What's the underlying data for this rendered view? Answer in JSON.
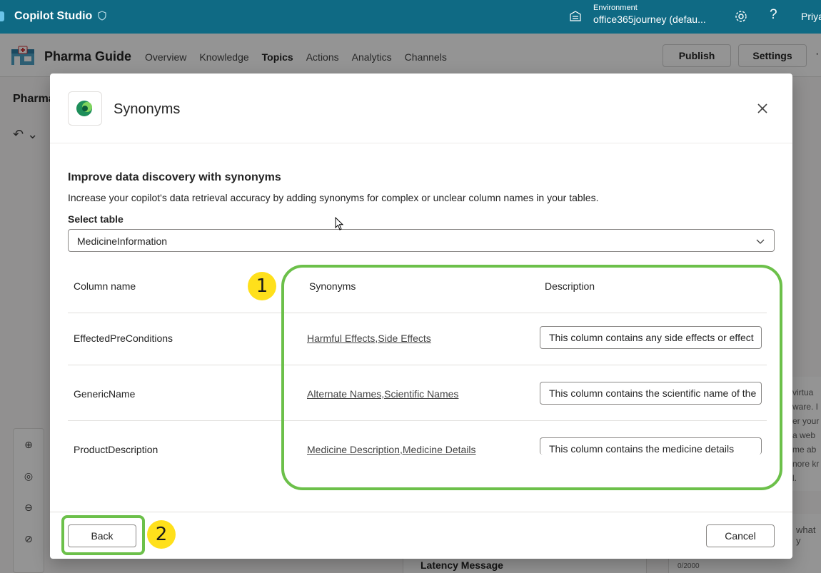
{
  "topbar": {
    "app_title": "Copilot Studio",
    "environment_label": "Environment",
    "environment_value": "office365journey (defau...",
    "user": "Priya"
  },
  "agent": {
    "name": "Pharma Guide",
    "nav": [
      "Overview",
      "Knowledge",
      "Topics",
      "Actions",
      "Analytics",
      "Channels"
    ],
    "active_nav": "Topics",
    "publish_label": "Publish",
    "settings_label": "Settings"
  },
  "background": {
    "left_title": "Pharma",
    "right_panel_lines": [
      "virtua",
      "ware. I",
      "er your",
      "a web",
      "me ab",
      "nore kr",
      "l."
    ],
    "latency_label": "Latency Message",
    "char_counter": "0/2000",
    "what_text": "what y"
  },
  "dialog": {
    "title": "Synonyms",
    "heading": "Improve data discovery with synonyms",
    "description": "Increase your copilot's data retrieval accuracy by adding synonyms for complex or unclear column names in your tables.",
    "select_label": "Select table",
    "select_value": "MedicineInformation",
    "columns": {
      "name": "Column name",
      "synonyms": "Synonyms",
      "description": "Description"
    },
    "rows": [
      {
        "column": "EffectedPreConditions",
        "synonyms": "Harmful Effects,Side Effects",
        "description": "This column contains any side effects or effect"
      },
      {
        "column": "GenericName",
        "synonyms": "Alternate Names,Scientific Names",
        "description": "This column contains the scientific name of the"
      },
      {
        "column": "ProductDescription",
        "synonyms": "Medicine Description,Medicine Details",
        "description": "This column contains the medicine details"
      }
    ],
    "back_label": "Back",
    "cancel_label": "Cancel"
  },
  "annotations": {
    "badge_1": "1",
    "badge_2": "2",
    "highlight_color": "#6cc04a",
    "badge_color": "#ffe01b"
  },
  "colors": {
    "topbar": "#0f6a84"
  }
}
